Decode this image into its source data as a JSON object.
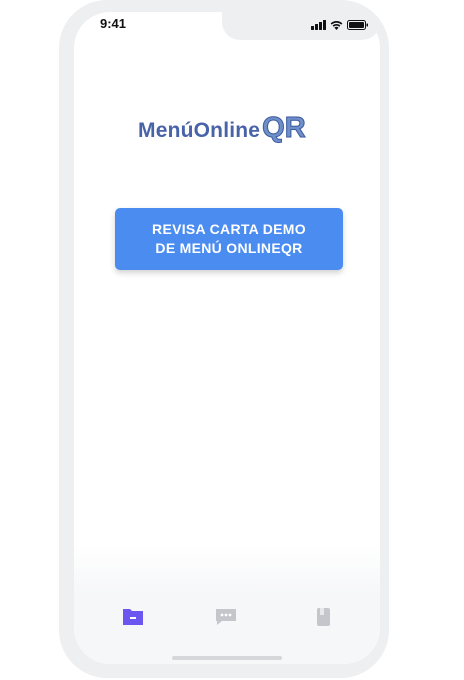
{
  "status_bar": {
    "time": "9:41",
    "icons": [
      "signal-icon",
      "wifi-icon",
      "battery-icon"
    ]
  },
  "logo": {
    "text": "MenúOnline",
    "accent": "QR"
  },
  "demo_button": {
    "line1": "REVISA CARTA DEMO",
    "line2": "DE MENÚ ONLINEQR"
  },
  "tab_bar": {
    "tabs": [
      {
        "icon": "folder-icon",
        "active": true
      },
      {
        "icon": "chat-icon",
        "active": false
      },
      {
        "icon": "book-icon",
        "active": false
      }
    ]
  },
  "colors": {
    "button": "#4a8cf0",
    "logo": "#4863a8",
    "active_tab": "#6c56f0",
    "inactive_tab": "#c4c6cc"
  }
}
